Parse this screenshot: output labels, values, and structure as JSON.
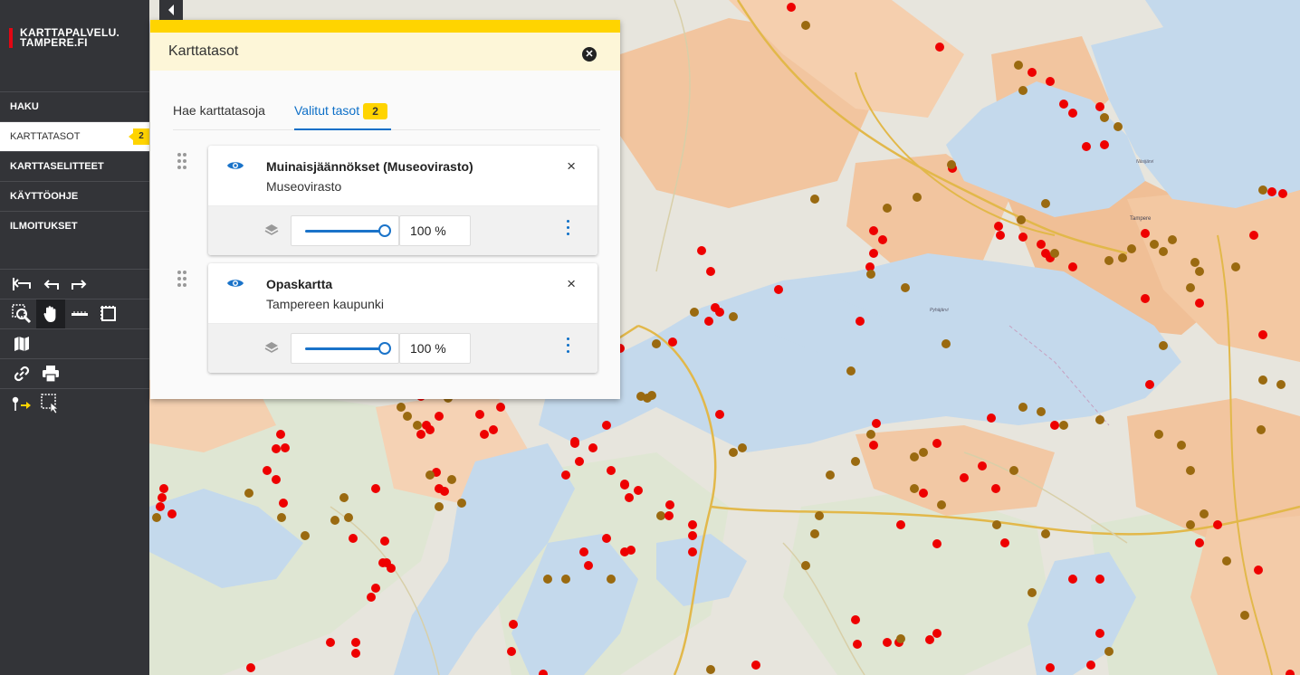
{
  "logo": {
    "line1": "KARTTAPALVELU.",
    "line2": "TAMPERE.FI"
  },
  "nav": {
    "items": [
      {
        "label": "HAKU"
      },
      {
        "label": "KARTTATASOT",
        "badge": "2"
      },
      {
        "label": "KARTTASELITTEET"
      },
      {
        "label": "KÄYTTÖOHJE"
      },
      {
        "label": "ILMOITUKSET"
      }
    ]
  },
  "tools": {
    "icons": [
      "reset-view-icon",
      "undo-icon",
      "redo-icon",
      "zoom-box-icon",
      "pan-hand-icon",
      "measure-line-icon",
      "measure-area-icon",
      "map-legend-icon",
      "link-icon",
      "print-icon",
      "coordinate-tool-icon",
      "select-features-icon"
    ]
  },
  "panel": {
    "title": "Karttatasot",
    "tabs": [
      {
        "label": "Hae karttatasoja"
      },
      {
        "label": "Valitut tasot",
        "badge": "2"
      }
    ],
    "layers": [
      {
        "name": "Muinaisjäännökset (Museovirasto)",
        "source": "Museovirasto",
        "opacity": "100 %",
        "opacity_value": 100
      },
      {
        "name": "Opaskartta",
        "source": "Tampereen kaupunki",
        "opacity": "100 %",
        "opacity_value": 100
      }
    ]
  },
  "colors": {
    "sidebar": "#333438",
    "accent_yellow": "#ffd400",
    "link_blue": "#0d6fc7",
    "dot_red": "#ee0000",
    "dot_brown": "#9a6a10",
    "water": "#c4d9ec",
    "urban": "#f4c49a"
  },
  "map": {
    "labels": [
      "Tampere",
      "Näsijärvi",
      "Pyhäjärvi"
    ]
  }
}
